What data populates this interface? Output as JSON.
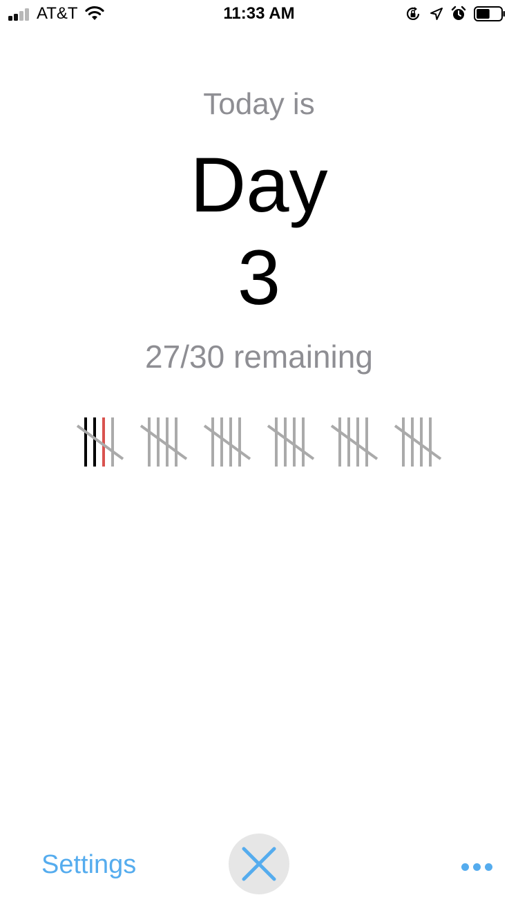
{
  "status_bar": {
    "carrier": "AT&T",
    "time": "11:33 AM",
    "signal_bars": 2,
    "signal_bars_total": 4,
    "battery_level": 0.55,
    "icons": [
      "signal-icon",
      "wifi-icon",
      "rotation-lock-icon",
      "location-arrow-icon",
      "alarm-clock-icon",
      "battery-icon"
    ]
  },
  "main": {
    "today_label": "Today is",
    "day_label": "Day",
    "day_number": "3",
    "remaining_text": "27/30 remaining"
  },
  "tally": {
    "groups": 6,
    "marks_per_group": 5,
    "completed_marks": 2,
    "current_mark": 3,
    "colors": {
      "completed": "#000000",
      "current": "#d9534f",
      "pending": "#aaaaaa"
    }
  },
  "bottom_bar": {
    "settings_label": "Settings",
    "close_icon": "close-icon",
    "more_icon": "more-dots-icon",
    "accent_color": "#55acee"
  }
}
